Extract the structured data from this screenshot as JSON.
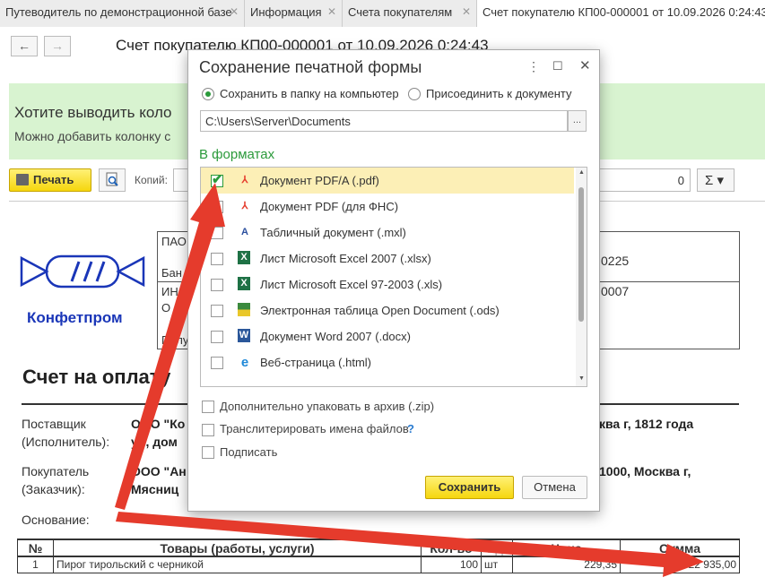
{
  "tabs": [
    {
      "label": "Путеводитель по демонстрационной базе"
    },
    {
      "label": "Информация"
    },
    {
      "label": "Счета покупателям"
    },
    {
      "label": "Счет покупателю КП00-000001 от 10.09.2026 0:24:43"
    }
  ],
  "header": {
    "doc_title": "Счет покупателю КП00-000001 от 10.09.2026 0:24:43",
    "nav_back": "←",
    "nav_forward": "→"
  },
  "banner": {
    "title": "Хотите выводить коло",
    "text": "Можно добавить колонку с"
  },
  "toolbar": {
    "print_label": "Печать",
    "copies_label": "Копий:",
    "zero_value": "0",
    "sum_label": "Σ ▾"
  },
  "document": {
    "logo_text": "Конфетпром",
    "bank_lines": [
      "ПАО",
      "Бан",
      "ИН",
      "О",
      "Полу"
    ],
    "right_values": [
      "0225",
      "0007"
    ],
    "invoice_heading": "Счет на оплату",
    "supplier_label_1": "Поставщик",
    "supplier_label_2": "(Исполнитель):",
    "supplier_value_1": "ООО \"Ко",
    "supplier_value_2": "ул, дом",
    "supplier_value_right": "ква г, 1812 года",
    "buyer_label_1": "Покупатель",
    "buyer_label_2": "(Заказчик):",
    "buyer_value_1": "ООО \"Ан",
    "buyer_value_2": "Мясниц",
    "buyer_value_right": "1000, Москва г,",
    "basis_label": "Основание:",
    "table": {
      "headers": [
        "№",
        "Товары (работы, услуги)",
        "Кол-во",
        "Ед.",
        "Цена",
        "Сумма"
      ],
      "rows": [
        [
          "1",
          "Пирог тирольский с черникой",
          "100",
          "шт",
          "229,35",
          "22 935,00"
        ]
      ]
    }
  },
  "dialog": {
    "title": "Сохранение печатной формы",
    "radio_save": "Сохранить в папку на компьютер",
    "radio_attach": "Присоединить к документу",
    "path_value": "C:\\Users\\Server\\Documents",
    "path_button": "...",
    "formats_label": "В форматах",
    "formats": [
      {
        "label": "Документ PDF/A (.pdf)",
        "checked": true,
        "icon": "pdf-icon"
      },
      {
        "label": "Документ PDF (для ФНС)",
        "checked": false,
        "icon": "pdf-icon"
      },
      {
        "label": "Табличный документ (.mxl)",
        "checked": false,
        "icon": "mxl-icon"
      },
      {
        "label": "Лист Microsoft Excel 2007 (.xlsx)",
        "checked": false,
        "icon": "excel-icon"
      },
      {
        "label": "Лист Microsoft Excel 97-2003 (.xls)",
        "checked": false,
        "icon": "excel-icon"
      },
      {
        "label": "Электронная таблица Open Document (.ods)",
        "checked": false,
        "icon": "ods-icon"
      },
      {
        "label": "Документ Word 2007 (.docx)",
        "checked": false,
        "icon": "word-icon"
      },
      {
        "label": "Веб-страница (.html)",
        "checked": false,
        "icon": "html-icon"
      }
    ],
    "opt_zip": "Дополнительно упаковать в архив (.zip)",
    "opt_translit": "Транслитерировать имена файлов",
    "opt_help": "?",
    "opt_sign": "Подписать",
    "save_button": "Сохранить",
    "cancel_button": "Отмена"
  },
  "colors": {
    "accent_green": "#2a9a3a",
    "button_yellow": "#f5d60e",
    "banner_green": "#d8f3d0",
    "arrow_red": "#e53b2c"
  }
}
